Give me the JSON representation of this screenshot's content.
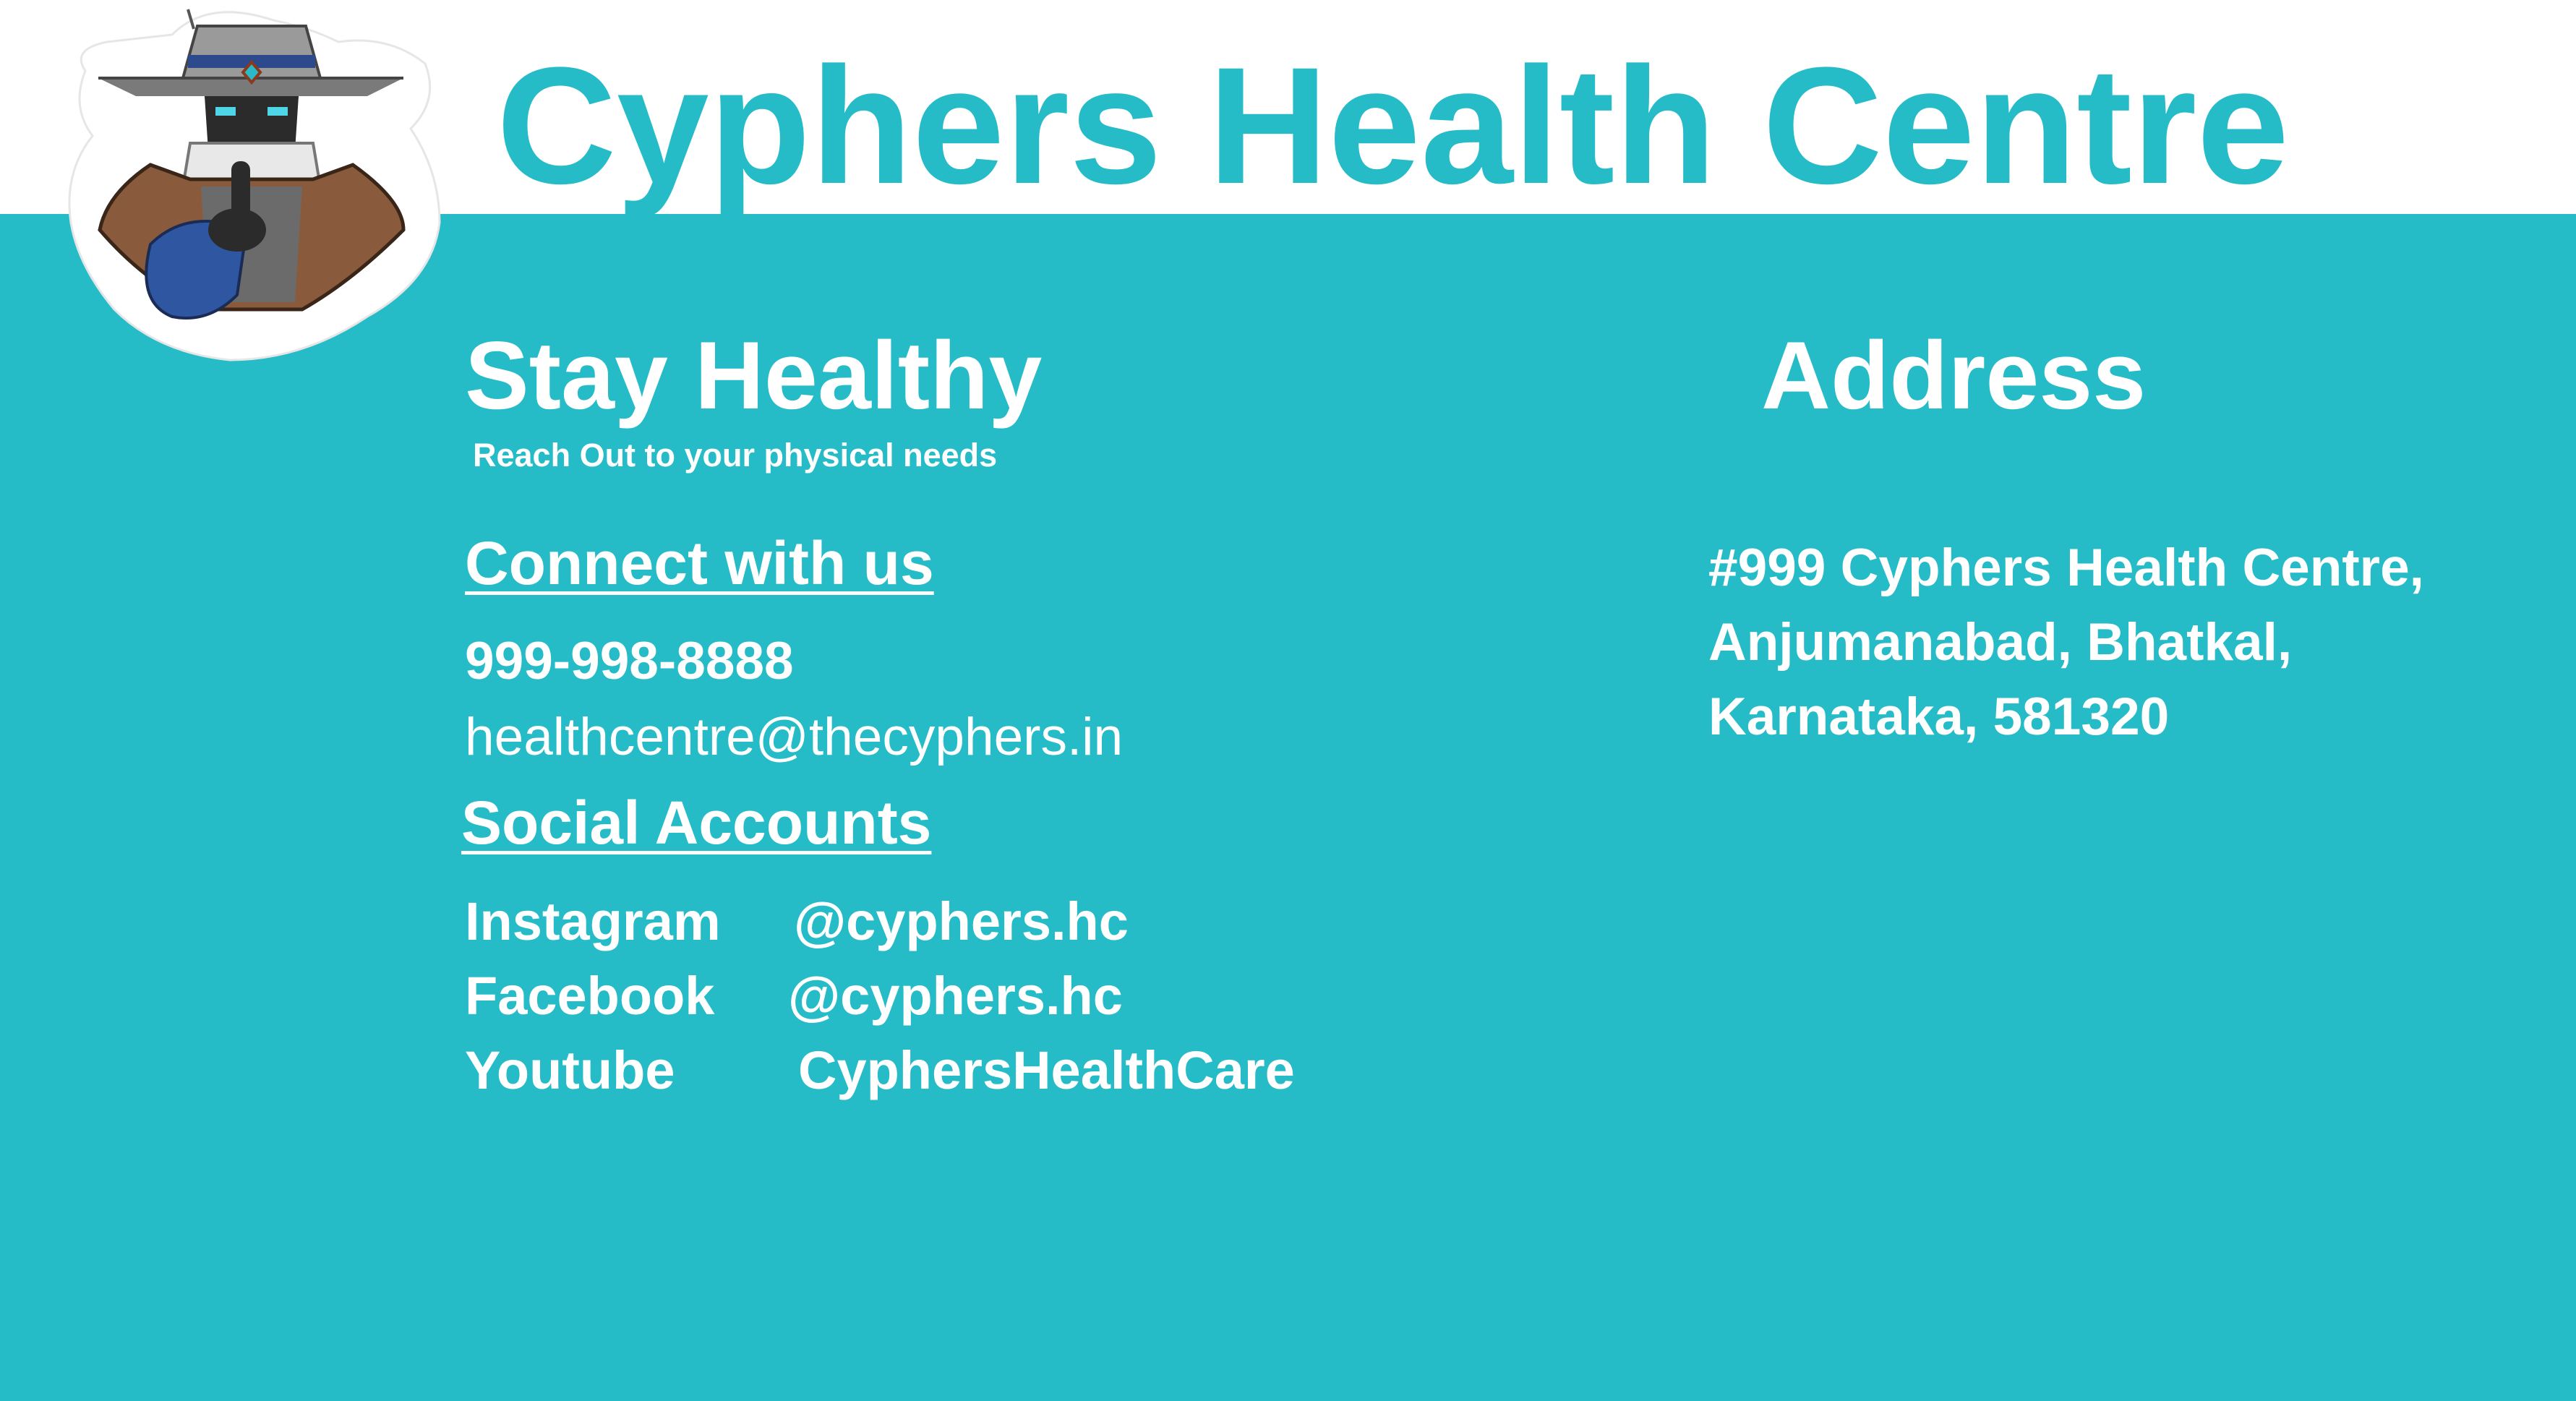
{
  "header": {
    "title": "Cyphers Health Centre",
    "logo_icon": "cyphers-mascot-icon"
  },
  "left": {
    "heading": "Stay Healthy",
    "tagline": "Reach Out to your physical needs",
    "connect_label": "Connect with us",
    "phone": "999-998-8888",
    "email": "healthcentre@thecyphers.in",
    "social_label": "Social Accounts",
    "socials": [
      {
        "platform": "Instagram",
        "handle": "@cyphers.hc"
      },
      {
        "platform": "Facebook",
        "handle": "@cyphers.hc"
      },
      {
        "platform": "Youtube",
        "handle": "CyphersHealthCare"
      }
    ]
  },
  "right": {
    "heading": "Address",
    "address_lines": [
      "#999 Cyphers Health Centre,",
      "Anjumanabad, Bhatkal,",
      "Karnataka, 581320"
    ]
  },
  "colors": {
    "brand_teal": "#25BCC8",
    "header_bg": "#FFFFFF",
    "text_on_teal": "#FFFFFF"
  }
}
